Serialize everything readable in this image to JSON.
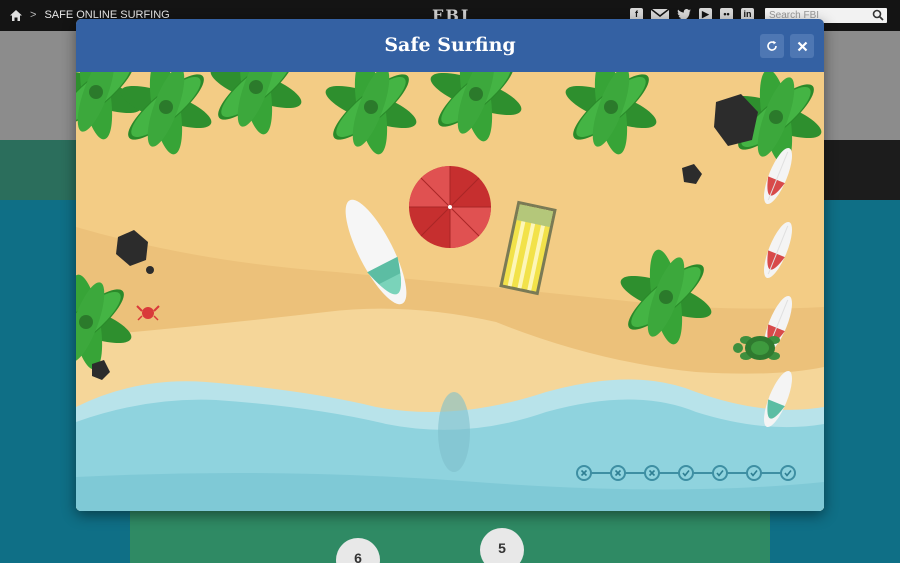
{
  "site": {
    "breadcrumb_home_icon": "home-icon",
    "breadcrumb_separator": ">",
    "breadcrumb_label": "SAFE ONLINE SURFING",
    "logo_text": "FBI",
    "social_icons": [
      "facebook-icon",
      "email-icon",
      "twitter-icon",
      "youtube-icon",
      "flickr-icon",
      "linkedin-icon"
    ],
    "search_placeholder": "Search FBI"
  },
  "map": {
    "levels": [
      "6",
      "5"
    ]
  },
  "modal": {
    "title": "Safe Surfing",
    "restart_icon": "refresh-icon",
    "close_icon": "close-icon"
  },
  "progress": {
    "steps": [
      "x",
      "x",
      "x",
      "check",
      "check",
      "check",
      "check"
    ]
  },
  "colors": {
    "header": "#3461a3",
    "sand": "#f3cc85",
    "water": "#8fd3de",
    "palm": "#3aa13a",
    "umbrella": "#d93a3a"
  }
}
